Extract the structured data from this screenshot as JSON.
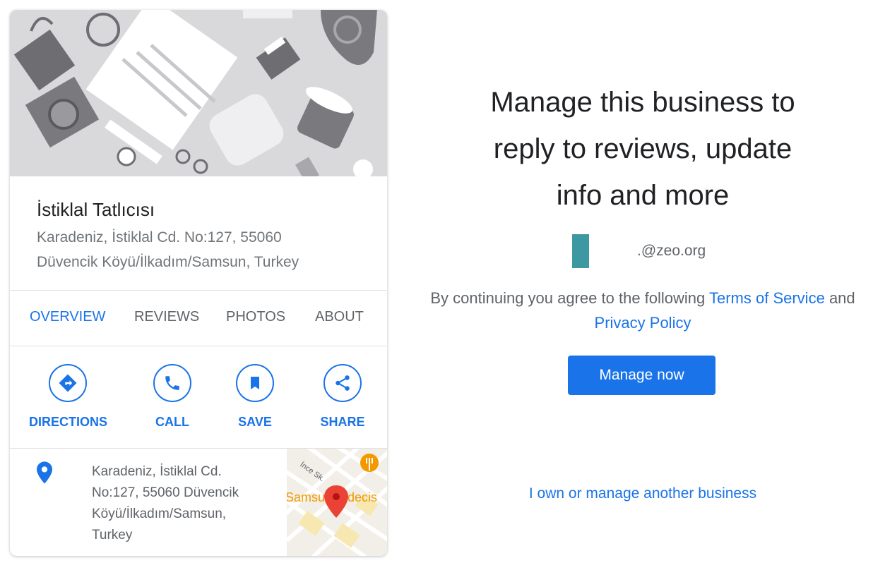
{
  "business": {
    "name": "İstiklal Tatlıcısı",
    "address_line1": "Karadeniz, İstiklal Cd. No:127, 55060",
    "address_line2": "Düvencik Köyü/İlkadım/Samsun, Turkey"
  },
  "tabs": [
    {
      "label": "OVERVIEW",
      "active": true
    },
    {
      "label": "REVIEWS",
      "active": false
    },
    {
      "label": "PHOTOS",
      "active": false
    },
    {
      "label": "ABOUT",
      "active": false
    }
  ],
  "actions": [
    {
      "label": "DIRECTIONS",
      "icon": "directions-icon"
    },
    {
      "label": "CALL",
      "icon": "phone-icon"
    },
    {
      "label": "SAVE",
      "icon": "bookmark-icon"
    },
    {
      "label": "SHARE",
      "icon": "share-icon"
    }
  ],
  "address_detail": {
    "line1": "Karadeniz, İstiklal Cd.",
    "line2": "No:127, 55060 Düvencik",
    "line3": "Köyü/İlkadım/Samsun,",
    "line4": "Turkey"
  },
  "map": {
    "street_label": "İnce Sk.",
    "place_label": "Samsun Hidecis"
  },
  "manage": {
    "headline_line1": "Manage this business to",
    "headline_line2": "reply to reviews, update",
    "headline_line3": "info and more",
    "account_email": ".@zeo.org",
    "terms_prefix": "By continuing you agree to the following",
    "terms_link1": "Terms of Service",
    "terms_and": "and",
    "terms_link2": "Privacy Policy",
    "button_label": "Manage now",
    "other_business_link": "I own or manage another business"
  },
  "colors": {
    "accent": "#1a73e8",
    "account_swatch": "#3d98a1",
    "hero_bg": "#d9d9dc"
  }
}
